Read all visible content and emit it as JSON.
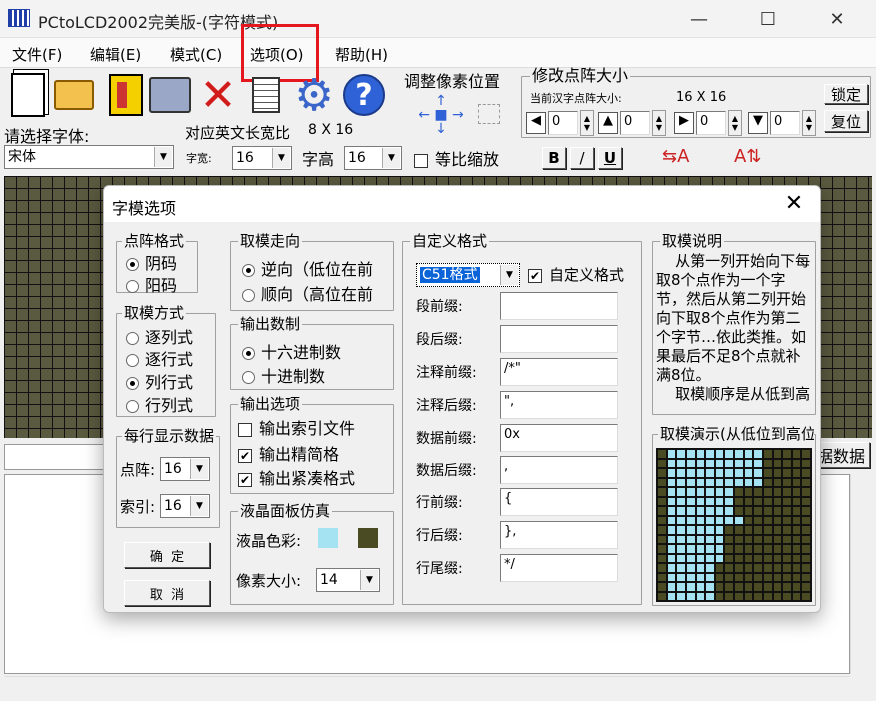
{
  "window": {
    "title": "PCtoLCD2002完美版-(字符模式)",
    "minimize": "—",
    "maximize": "☐",
    "close": "✕"
  },
  "menu": [
    "文件(F)",
    "编辑(E)",
    "模式(C)",
    "选项(O)",
    "帮助(H)"
  ],
  "toolbar": {
    "icons": [
      "new-file-icon",
      "open-folder-icon",
      "save-disk-icon",
      "convert-icon",
      "delete-x-icon",
      "notepad-icon",
      "gear-icon",
      "help-icon"
    ],
    "pixel_pos_label": "调整像素位置",
    "dot_size_label": "修改点阵大小",
    "current_size_label": "当前汉字点阵大小:",
    "current_size_value": "16 X 16",
    "lock_button": "锁定",
    "reset_button": "复位",
    "spin_values": [
      "0",
      "0",
      "0",
      "0"
    ]
  },
  "font_row": {
    "choose_font_label": "请选择字体:",
    "font_value": "宋体",
    "eng_ratio_label": "对应英文长宽比",
    "eng_ratio_value": "8 X 16",
    "width_label": "字宽:",
    "width_value": "16",
    "height_label": "字高",
    "height_value": "16",
    "proportional_label": "等比缩放",
    "bold": "B",
    "italic": "/",
    "underline": "U"
  },
  "bottom": {
    "data_button_fragment": "据数据"
  },
  "dialog": {
    "title": "字模选项",
    "dot_format": {
      "title": "点阵格式",
      "options": [
        "阴码",
        "阳码"
      ],
      "selected": 0
    },
    "take_mode": {
      "title": "取模方式",
      "options": [
        "逐列式",
        "逐行式",
        "列行式",
        "行列式"
      ],
      "selected": 2
    },
    "per_row": {
      "title": "每行显示数据",
      "dot_label": "点阵:",
      "dot_value": "16",
      "index_label": "索引:",
      "index_value": "16"
    },
    "ok_button": "确  定",
    "cancel_button": "取  消",
    "direction": {
      "title": "取模走向",
      "options": [
        "逆向（低位在前",
        "顺向（高位在前"
      ],
      "selected": 0
    },
    "number_base": {
      "title": "输出数制",
      "options": [
        "十六进制数",
        "十进制数"
      ],
      "selected": 0
    },
    "output_opts": {
      "title": "输出选项",
      "options": [
        {
          "label": "输出索引文件",
          "checked": false
        },
        {
          "label": "输出精简格",
          "checked": true
        },
        {
          "label": "输出紧凑格式",
          "checked": true
        }
      ]
    },
    "lcd_sim": {
      "title": "液晶面板仿真",
      "color_label": "液晶色彩:",
      "color_light": "#a6e3f2",
      "color_dark": "#4b4b23",
      "pixel_label": "像素大小:",
      "pixel_value": "14"
    },
    "custom_format": {
      "title": "自定义格式",
      "format_value": "C51格式",
      "custom_check_label": "自定义格式",
      "fields": [
        {
          "label": "段前缀:",
          "value": ""
        },
        {
          "label": "段后缀:",
          "value": ""
        },
        {
          "label": "注释前缀:",
          "value": "/*\""
        },
        {
          "label": "注释后缀:",
          "value": "\","
        },
        {
          "label": "数据前缀:",
          "value": "0x"
        },
        {
          "label": "数据后缀:",
          "value": ","
        },
        {
          "label": "行前缀:",
          "value": "{"
        },
        {
          "label": "行后缀:",
          "value": "},"
        },
        {
          "label": "行尾缀:",
          "value": "*/"
        }
      ]
    },
    "take_desc": {
      "title": "取模说明",
      "text": "    从第一列开始向下每取8个点作为一个字节，然后从第二列开始向下取8个点作为第二个字节…依此类推。如果最后不足8个点就补满8位。\n    取模顺序是从低到高"
    },
    "demo": {
      "title": "取模演示(从低位到高位)"
    }
  }
}
